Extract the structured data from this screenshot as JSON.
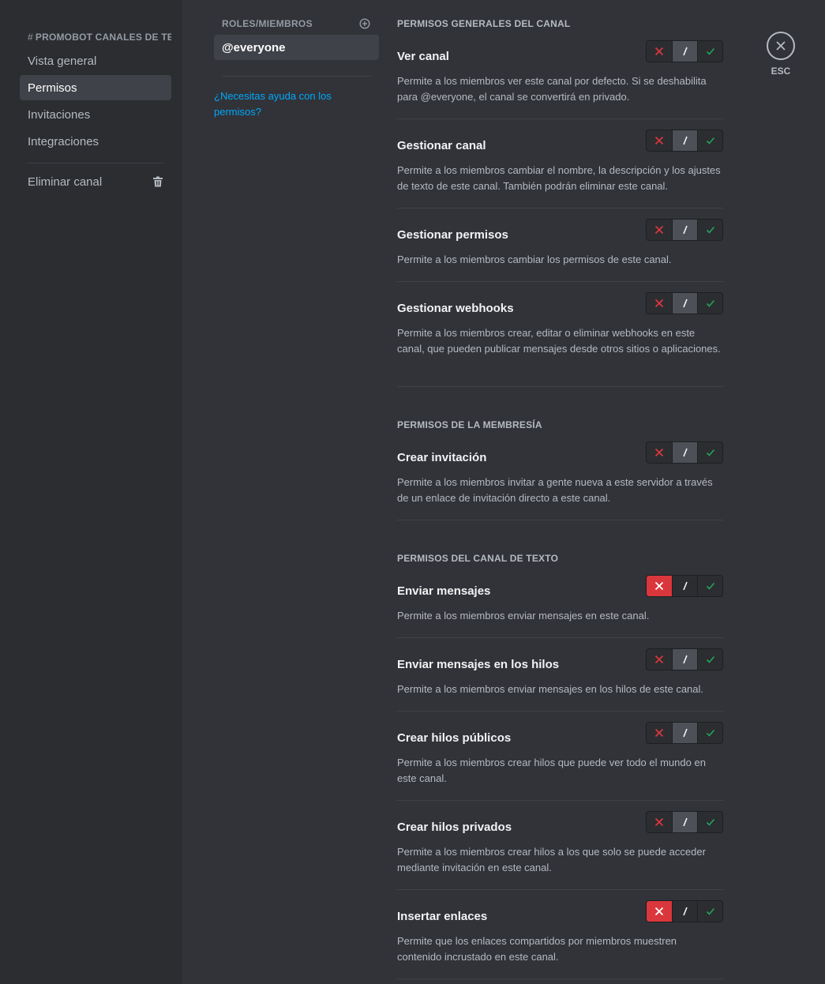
{
  "sidebar": {
    "channel_header": "PROMOBOT CANALES DE TEXTO",
    "hash": "#",
    "items": [
      {
        "label": "Vista general"
      },
      {
        "label": "Permisos"
      },
      {
        "label": "Invitaciones"
      },
      {
        "label": "Integraciones"
      }
    ],
    "delete_label": "Eliminar canal"
  },
  "roles": {
    "header": "ROLES/MIEMBROS",
    "selected_role": "@everyone",
    "help_link": "¿Necesitas ayuda con los permisos?"
  },
  "close": {
    "label": "ESC"
  },
  "sections": [
    {
      "title": "PERMISOS GENERALES DEL CANAL"
    },
    {
      "title": "PERMISOS DE LA MEMBRESÍA"
    },
    {
      "title": "PERMISOS DEL CANAL DE TEXTO"
    }
  ],
  "permissions": [
    {
      "name": "Ver canal",
      "desc": "Permite a los miembros ver este canal por defecto. Si se deshabilita para @everyone, el canal se convertirá en privado.",
      "state": "neutral"
    },
    {
      "name": "Gestionar canal",
      "desc": "Permite a los miembros cambiar el nombre, la descripción y los ajustes de texto de este canal. También podrán eliminar este canal.",
      "state": "neutral"
    },
    {
      "name": "Gestionar permisos",
      "desc": "Permite a los miembros cambiar los permisos de este canal.",
      "state": "neutral"
    },
    {
      "name": "Gestionar webhooks",
      "desc": "Permite a los miembros crear, editar o eliminar webhooks en este canal, que pueden publicar mensajes desde otros sitios o aplicaciones.",
      "state": "neutral"
    },
    {
      "name": "Crear invitación",
      "desc": "Permite a los miembros invitar a gente nueva a este servidor a través de un enlace de invitación directo a este canal.",
      "state": "neutral"
    },
    {
      "name": "Enviar mensajes",
      "desc": "Permite a los miembros enviar mensajes en este canal.",
      "state": "deny"
    },
    {
      "name": "Enviar mensajes en los hilos",
      "desc": "Permite a los miembros enviar mensajes en los hilos de este canal.",
      "state": "neutral"
    },
    {
      "name": "Crear hilos públicos",
      "desc": "Permite a los miembros crear hilos que puede ver todo el mundo en este canal.",
      "state": "neutral"
    },
    {
      "name": "Crear hilos privados",
      "desc": "Permite a los miembros crear hilos a los que solo se puede acceder mediante invitación en este canal.",
      "state": "neutral"
    },
    {
      "name": "Insertar enlaces",
      "desc": "Permite que los enlaces compartidos por miembros muestren contenido incrustado en este canal.",
      "state": "deny"
    }
  ],
  "colors": {
    "deny": "#da373c",
    "allow": "#23a55a",
    "link": "#00a8fc"
  }
}
